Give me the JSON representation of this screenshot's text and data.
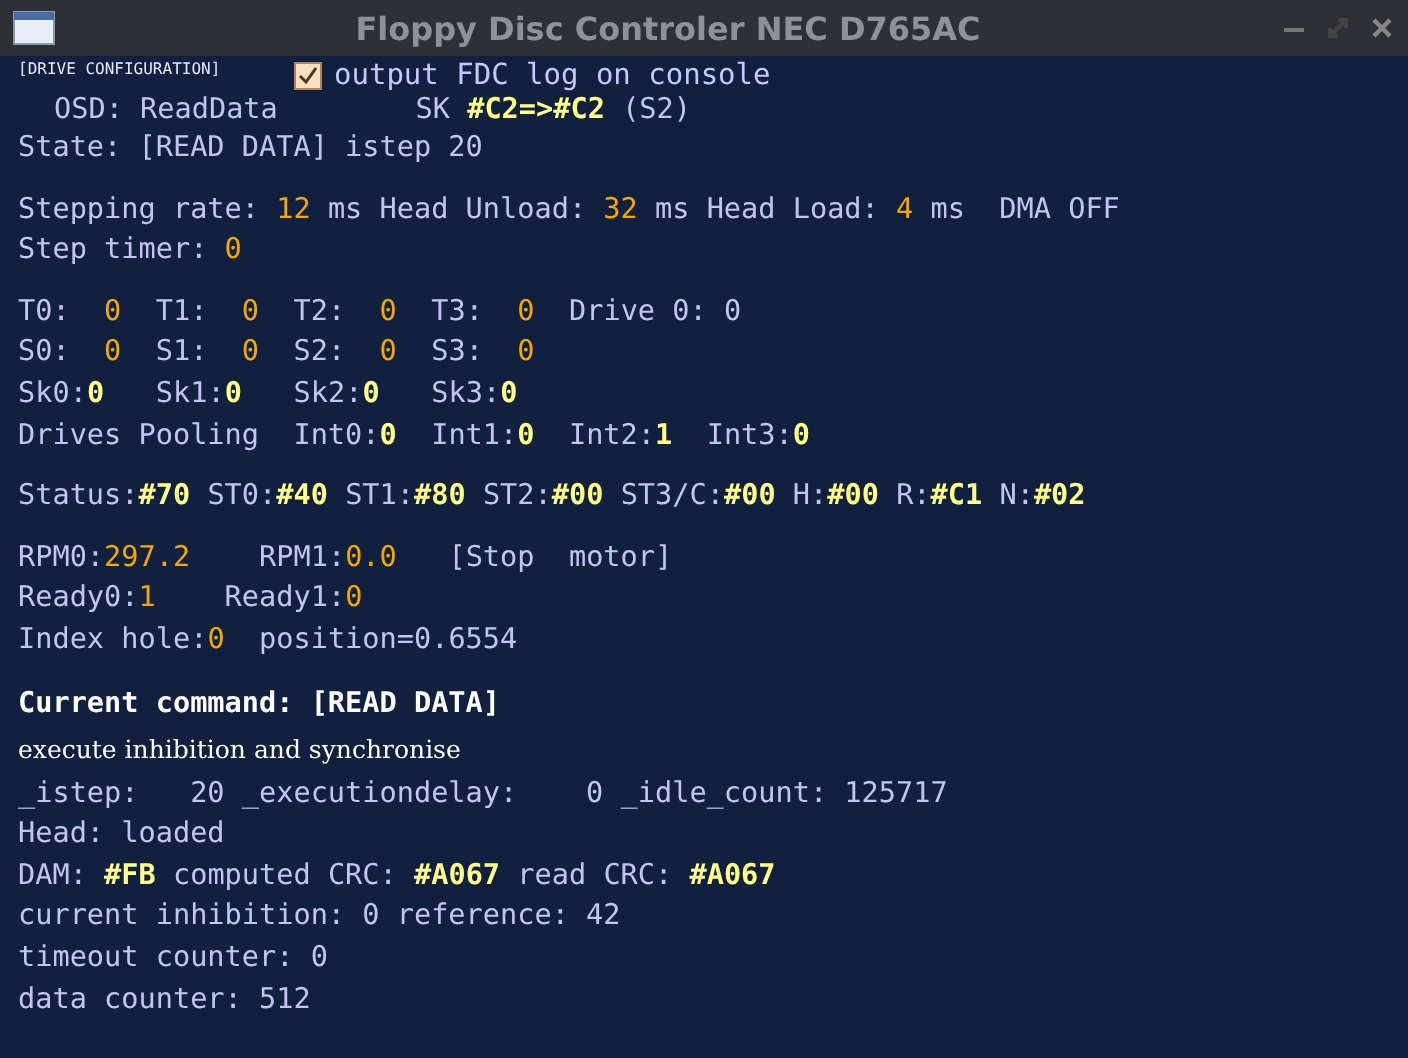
{
  "window": {
    "title": "Floppy Disc Controler NEC D765AC"
  },
  "header": {
    "section_label": "[DRIVE CONFIGURATION]",
    "log_checkbox": {
      "label": "output FDC log on console",
      "checked": true
    }
  },
  "groups": [
    {
      "lines": [
        {
          "kind": "indented",
          "segments": [
            {
              "text": "OSD: ReadData        SK ",
              "kind": "label"
            },
            {
              "text": "#C2=>#C2",
              "kind": "yellow"
            },
            {
              "text": " (S2)",
              "kind": "label"
            }
          ]
        },
        {
          "kind": "plain",
          "segments": [
            {
              "text": "State: [READ DATA] istep 20",
              "kind": "label"
            }
          ]
        }
      ]
    },
    {
      "lines": [
        {
          "kind": "plain",
          "segments": [
            {
              "text": "Stepping rate: ",
              "kind": "label"
            },
            {
              "text": "12",
              "kind": "orange"
            },
            {
              "text": " ms Head Unload: ",
              "kind": "label"
            },
            {
              "text": "32",
              "kind": "orange"
            },
            {
              "text": " ms Head Load: ",
              "kind": "label"
            },
            {
              "text": "4",
              "kind": "orange"
            },
            {
              "text": " ms  DMA OFF",
              "kind": "label"
            }
          ]
        },
        {
          "kind": "plain",
          "segments": [
            {
              "text": "Step timer: ",
              "kind": "label"
            },
            {
              "text": "0",
              "kind": "orange"
            }
          ]
        }
      ]
    },
    {
      "lines": [
        {
          "kind": "plain",
          "segments": [
            {
              "text": "T0:  ",
              "kind": "label"
            },
            {
              "text": "0",
              "kind": "orange"
            },
            {
              "text": "  T1:  ",
              "kind": "label"
            },
            {
              "text": "0",
              "kind": "orange"
            },
            {
              "text": "  T2:  ",
              "kind": "label"
            },
            {
              "text": "0",
              "kind": "orange"
            },
            {
              "text": "  T3:  ",
              "kind": "label"
            },
            {
              "text": "0",
              "kind": "orange"
            },
            {
              "text": "  Drive 0: 0",
              "kind": "label"
            }
          ]
        },
        {
          "kind": "plain",
          "segments": [
            {
              "text": "S0:  ",
              "kind": "label"
            },
            {
              "text": "0",
              "kind": "orange"
            },
            {
              "text": "  S1:  ",
              "kind": "label"
            },
            {
              "text": "0",
              "kind": "orange"
            },
            {
              "text": "  S2:  ",
              "kind": "label"
            },
            {
              "text": "0",
              "kind": "orange"
            },
            {
              "text": "  S3:  ",
              "kind": "label"
            },
            {
              "text": "0",
              "kind": "orange"
            }
          ]
        },
        {
          "kind": "plain",
          "segments": [
            {
              "text": "Sk0:",
              "kind": "label"
            },
            {
              "text": "0",
              "kind": "yellow"
            },
            {
              "text": "   Sk1:",
              "kind": "label"
            },
            {
              "text": "0",
              "kind": "yellow"
            },
            {
              "text": "   Sk2:",
              "kind": "label"
            },
            {
              "text": "0",
              "kind": "yellow"
            },
            {
              "text": "   Sk3:",
              "kind": "label"
            },
            {
              "text": "0",
              "kind": "yellow"
            }
          ]
        },
        {
          "kind": "plain",
          "segments": [
            {
              "text": "Drives Pooling  Int0:",
              "kind": "label"
            },
            {
              "text": "0",
              "kind": "yellow"
            },
            {
              "text": "  Int1:",
              "kind": "label"
            },
            {
              "text": "0",
              "kind": "yellow"
            },
            {
              "text": "  Int2:",
              "kind": "label"
            },
            {
              "text": "1",
              "kind": "yellow"
            },
            {
              "text": "  Int3:",
              "kind": "label"
            },
            {
              "text": "0",
              "kind": "yellow"
            }
          ]
        }
      ]
    },
    {
      "lines": [
        {
          "kind": "plain",
          "segments": [
            {
              "text": "Status:",
              "kind": "label"
            },
            {
              "text": "#70",
              "kind": "yellow"
            },
            {
              "text": " ST0:",
              "kind": "label"
            },
            {
              "text": "#40",
              "kind": "yellow"
            },
            {
              "text": " ST1:",
              "kind": "label"
            },
            {
              "text": "#80",
              "kind": "yellow"
            },
            {
              "text": " ST2:",
              "kind": "label"
            },
            {
              "text": "#00",
              "kind": "yellow"
            },
            {
              "text": " ST3/C:",
              "kind": "label"
            },
            {
              "text": "#00",
              "kind": "yellow"
            },
            {
              "text": " H:",
              "kind": "label"
            },
            {
              "text": "#00",
              "kind": "yellow"
            },
            {
              "text": " R:",
              "kind": "label"
            },
            {
              "text": "#C1",
              "kind": "yellow"
            },
            {
              "text": " N:",
              "kind": "label"
            },
            {
              "text": "#02",
              "kind": "yellow"
            }
          ]
        }
      ]
    },
    {
      "lines": [
        {
          "kind": "plain",
          "segments": [
            {
              "text": "RPM0:",
              "kind": "label"
            },
            {
              "text": "297.2",
              "kind": "orange"
            },
            {
              "text": "    RPM1:",
              "kind": "label"
            },
            {
              "text": "0.0",
              "kind": "orange"
            },
            {
              "text": "   [Stop  motor]",
              "kind": "label"
            }
          ]
        },
        {
          "kind": "plain",
          "segments": [
            {
              "text": "Ready0:",
              "kind": "label"
            },
            {
              "text": "1",
              "kind": "orange"
            },
            {
              "text": "    Ready1:",
              "kind": "label"
            },
            {
              "text": "0",
              "kind": "orange"
            }
          ]
        },
        {
          "kind": "plain",
          "segments": [
            {
              "text": "Index hole:",
              "kind": "label"
            },
            {
              "text": "0",
              "kind": "orange"
            },
            {
              "text": "  position=0.6554",
              "kind": "label"
            }
          ]
        }
      ]
    },
    {
      "lines": [
        {
          "kind": "heading",
          "segments": [
            {
              "text": "Current command: [READ DATA]",
              "kind": "label"
            }
          ]
        },
        {
          "kind": "note",
          "segments": [
            {
              "text": "execute inhibition and synchronise",
              "kind": "label"
            }
          ]
        },
        {
          "kind": "plain",
          "segments": [
            {
              "text": "_istep:   20 _executiondelay:    0 _idle_count: 125717",
              "kind": "label"
            }
          ]
        },
        {
          "kind": "plain",
          "segments": [
            {
              "text": "Head: loaded",
              "kind": "label"
            }
          ]
        },
        {
          "kind": "plain",
          "segments": [
            {
              "text": "DAM: ",
              "kind": "label"
            },
            {
              "text": "#FB",
              "kind": "yellow"
            },
            {
              "text": " computed CRC: ",
              "kind": "label"
            },
            {
              "text": "#A067",
              "kind": "yellow"
            },
            {
              "text": " read CRC: ",
              "kind": "label"
            },
            {
              "text": "#A067",
              "kind": "yellow"
            }
          ]
        },
        {
          "kind": "plain",
          "segments": [
            {
              "text": "current inhibition: 0 reference: 42",
              "kind": "label"
            }
          ]
        },
        {
          "kind": "plain",
          "segments": [
            {
              "text": "timeout counter: 0",
              "kind": "label"
            }
          ]
        },
        {
          "kind": "plain",
          "segments": [
            {
              "text": "data counter: 512",
              "kind": "label"
            }
          ]
        }
      ]
    }
  ]
}
